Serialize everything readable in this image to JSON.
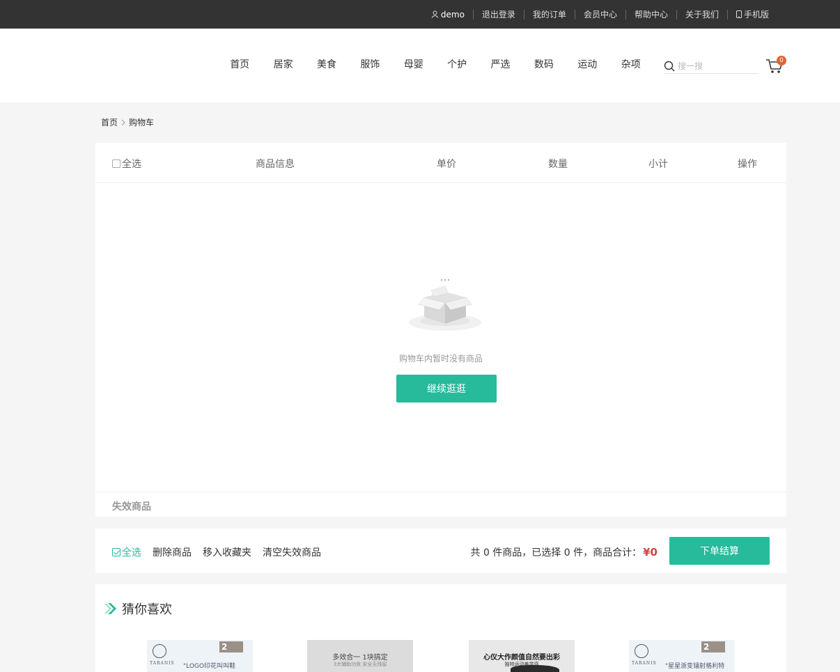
{
  "topbar": {
    "user": "demo",
    "links": [
      "退出登录",
      "我的订单",
      "会员中心",
      "帮助中心",
      "关于我们"
    ],
    "mobile": "手机版"
  },
  "nav": {
    "items": [
      "首页",
      "居家",
      "美食",
      "服饰",
      "母婴",
      "个护",
      "严选",
      "数码",
      "运动",
      "杂项"
    ]
  },
  "search": {
    "placeholder": "搜一搜"
  },
  "cart": {
    "badge": "0"
  },
  "breadcrumb": {
    "home": "首页",
    "current": "购物车"
  },
  "cart_table": {
    "select_all": "全选",
    "columns": [
      "商品信息",
      "单价",
      "数量",
      "小计",
      "操作"
    ],
    "empty_text": "购物车内暂时没有商品",
    "continue_button": "继续逛逛",
    "invalid_title": "失效商品"
  },
  "action_bar": {
    "select_all": "全选",
    "delete": "删除商品",
    "move_favorite": "移入收藏夹",
    "clear_invalid": "清空失效商品",
    "summary": "共 0 件商品，已选择 0 件，商品合计：",
    "total": "¥0",
    "checkout": "下单结算"
  },
  "recommend": {
    "title": "猜你喜欢",
    "products": [
      {
        "badge": "2",
        "brand": "TARANIS",
        "caption": "\"LOGO印花叫叫鞋"
      },
      {
        "headline": "多效合一 1块搞定",
        "sub": "3大辅助功效 安全无残留"
      },
      {
        "headline": "心仪大作颜值自然要出彩",
        "sub": "独特运动美学感"
      },
      {
        "badge": "2",
        "brand": "TARANIS",
        "caption": "\"星星浙变镭射格利特"
      }
    ]
  },
  "colors": {
    "accent": "#27ba9b",
    "price": "#cf4444",
    "badge": "#e26237",
    "topbar": "#333333"
  }
}
